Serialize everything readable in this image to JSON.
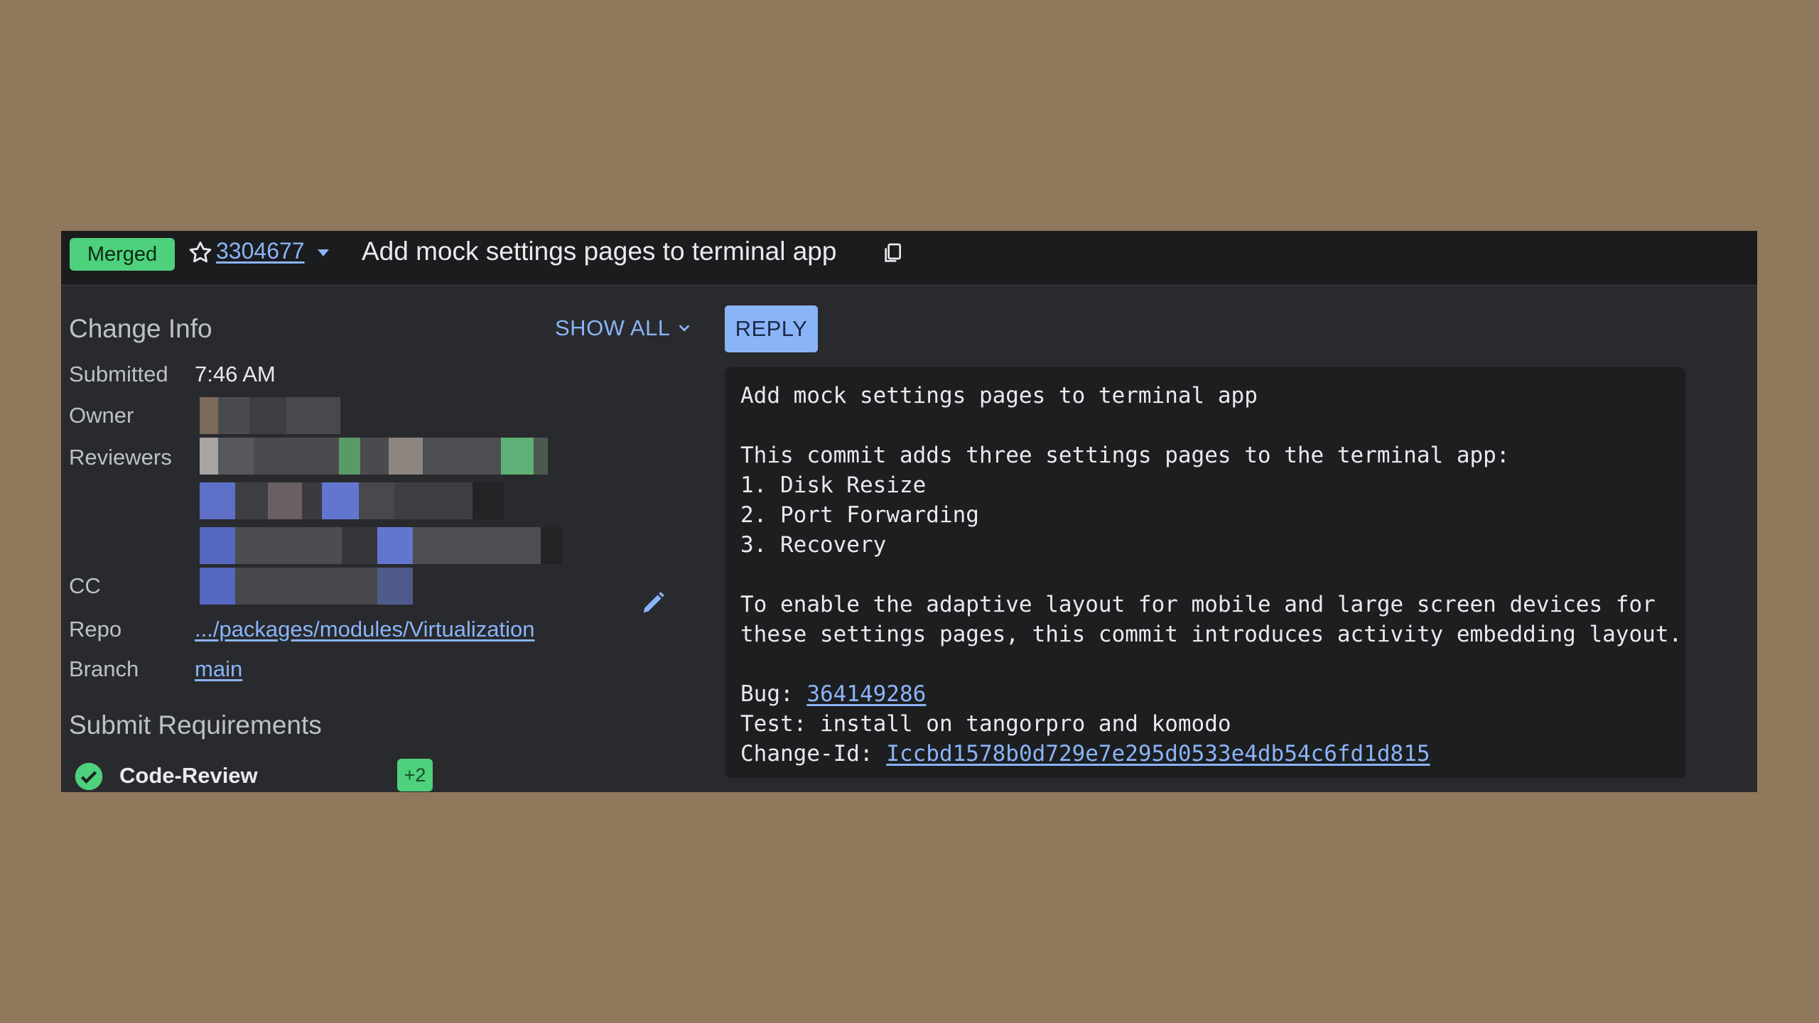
{
  "header": {
    "status_badge": "Merged",
    "change_number": "3304677",
    "title": "Add mock settings pages to terminal app"
  },
  "change_info": {
    "section_title": "Change Info",
    "show_all_label": "SHOW ALL",
    "submitted_label": "Submitted",
    "submitted_value": "7:46 AM",
    "owner_label": "Owner",
    "reviewers_label": "Reviewers",
    "cc_label": "CC",
    "repo_label": "Repo",
    "repo_value": ".../packages/modules/Virtualization",
    "branch_label": "Branch",
    "branch_value": "main"
  },
  "submit_requirements": {
    "section_title": "Submit Requirements",
    "items": [
      {
        "label": "Code-Review",
        "vote": "+2",
        "status": "satisfied"
      }
    ]
  },
  "reply_label": "REPLY",
  "commit_message": {
    "subject": "Add mock settings pages to terminal app",
    "intro": "This commit adds three settings pages to the terminal app:",
    "list": [
      "1. Disk Resize",
      "2. Port Forwarding",
      "3. Recovery"
    ],
    "paragraph_line1": "To enable the adaptive layout for mobile and large screen devices for",
    "paragraph_line2": "these settings pages, this commit introduces activity embedding layout.",
    "bug_label": "Bug: ",
    "bug_value": "364149286",
    "test_line": "Test: install on tangorpro and komodo",
    "change_id_label": "Change-Id: ",
    "change_id_value": "Iccbd1578b0d729e7e295d0533e4db54c6fd1d815"
  },
  "colors": {
    "background": "#8f785c",
    "merged_green": "#4ed17c",
    "link_blue": "#8ab4f8",
    "panel_dark": "#292a2d"
  },
  "icons": [
    "star-icon",
    "chevron-down-icon",
    "copy-icon",
    "edit-icon",
    "check-circle-icon"
  ]
}
